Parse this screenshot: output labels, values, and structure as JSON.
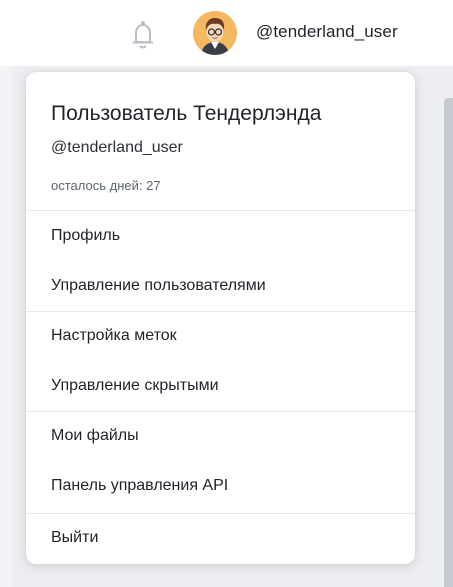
{
  "header": {
    "username": "@tenderland_user",
    "bell_icon": "bell-icon",
    "avatar_icon": "avatar"
  },
  "dropdown": {
    "full_name": "Пользователь Тендерлэнда",
    "handle": "@tenderland_user",
    "days_left": "осталось дней: 27",
    "items": [
      {
        "label": "Профиль"
      },
      {
        "label": "Управление пользователями"
      },
      {
        "label": "Настройка меток"
      },
      {
        "label": "Управление скрытыми"
      },
      {
        "label": "Мои файлы"
      },
      {
        "label": "Панель управления API"
      },
      {
        "label": "Выйти"
      }
    ]
  },
  "colors": {
    "bell": "#b9bec6",
    "avatar_bg": "#f4b860",
    "divider": "#e6e8eb"
  }
}
